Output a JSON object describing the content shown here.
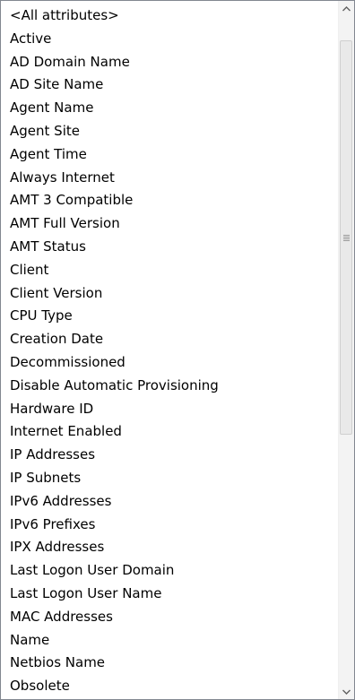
{
  "listbox": {
    "items": [
      "<All attributes>",
      "Active",
      "AD Domain Name",
      "AD Site Name",
      "Agent Name",
      "Agent Site",
      "Agent Time",
      "Always Internet",
      "AMT 3 Compatible",
      "AMT Full Version",
      "AMT Status",
      "Client",
      "Client Version",
      "CPU Type",
      "Creation Date",
      "Decommissioned",
      "Disable Automatic Provisioning",
      "Hardware ID",
      "Internet Enabled",
      "IP Addresses",
      "IP Subnets",
      "IPv6 Addresses",
      "IPv6 Prefixes",
      "IPX Addresses",
      "Last Logon User Domain",
      "Last Logon User Name",
      "MAC Addresses",
      "Name",
      "Netbios Name",
      "Obsolete"
    ]
  },
  "scrollbar": {
    "up_icon": "scroll-up-arrow-icon",
    "down_icon": "scroll-down-arrow-icon",
    "grip_icon": "scroll-grip-icon",
    "track_color": "#f3f3f3",
    "arrow_color": "#606060"
  }
}
